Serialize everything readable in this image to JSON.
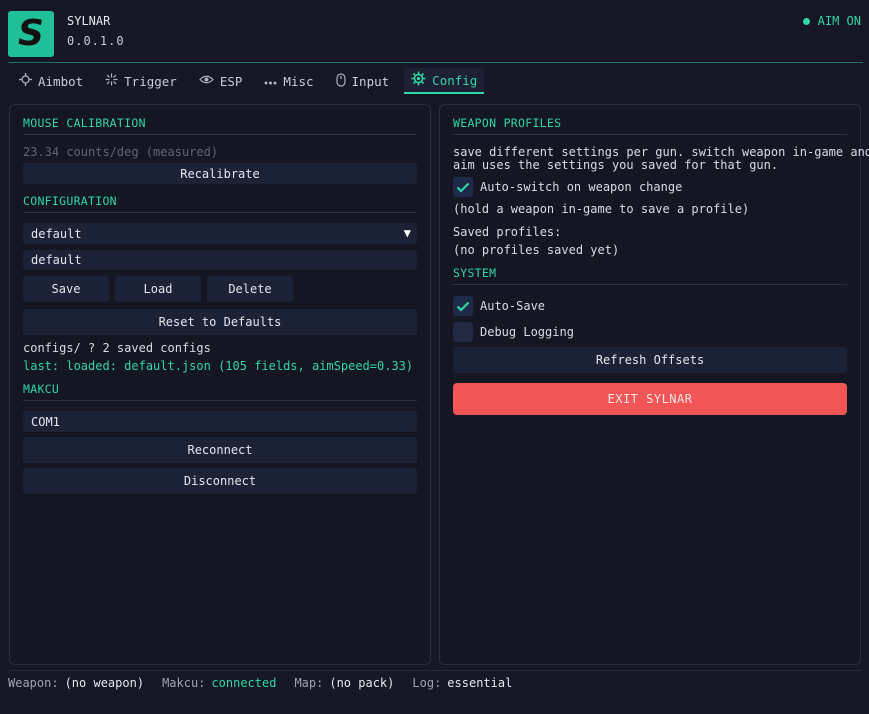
{
  "header": {
    "logo_letter": "S",
    "app_name": "SYLNAR",
    "version": "0.0.1.0",
    "aim_status": "AIM ON"
  },
  "tabs": [
    {
      "label": "Aimbot",
      "icon": "crosshair-icon"
    },
    {
      "label": "Trigger",
      "icon": "trigger-icon"
    },
    {
      "label": "ESP",
      "icon": "eye-icon"
    },
    {
      "label": "Misc",
      "icon": "dots-icon"
    },
    {
      "label": "Input",
      "icon": "mouse-icon"
    },
    {
      "label": "Config",
      "icon": "gear-icon",
      "active": true
    }
  ],
  "left": {
    "mouse_calibration": {
      "title": "MOUSE CALIBRATION",
      "measured": "23.34 counts/deg (measured)",
      "recalibrate": "Recalibrate"
    },
    "configuration": {
      "title": "CONFIGURATION",
      "selected": "default",
      "name_value": "default",
      "save": "Save",
      "load": "Load",
      "delete": "Delete",
      "reset": "Reset to Defaults",
      "status": "configs/ ? 2 saved configs",
      "last_loaded": "last: loaded: default.json (105 fields, aimSpeed=0.33)"
    },
    "makcu": {
      "title": "MAKCU",
      "port": "COM1",
      "reconnect": "Reconnect",
      "disconnect": "Disconnect"
    }
  },
  "right": {
    "weapon_profiles": {
      "title": "WEAPON PROFILES",
      "desc_line1": "save different settings per gun. switch weapon in-game and",
      "desc_line2": "aim uses the settings you saved for that gun.",
      "auto_switch": "Auto-switch on weapon change",
      "auto_switch_checked": true,
      "hint": "(hold a weapon in-game to save a profile)",
      "saved_label": "Saved profiles:",
      "saved_value": "(no profiles saved yet)"
    },
    "system": {
      "title": "SYSTEM",
      "auto_save": "Auto-Save",
      "auto_save_checked": true,
      "debug_logging": "Debug Logging",
      "debug_logging_checked": false,
      "refresh": "Refresh Offsets",
      "exit": "EXIT SYLNAR"
    }
  },
  "footer": {
    "weapon_label": "Weapon:",
    "weapon_value": "(no weapon)",
    "makcu_label": "Makcu:",
    "makcu_value": "connected",
    "map_label": "Map:",
    "map_value": "(no pack)",
    "log_label": "Log:",
    "log_value": "essential"
  },
  "colors": {
    "accent": "#2fd6a6",
    "background": "#151726",
    "button": "#1c2236",
    "danger": "#f25555"
  }
}
